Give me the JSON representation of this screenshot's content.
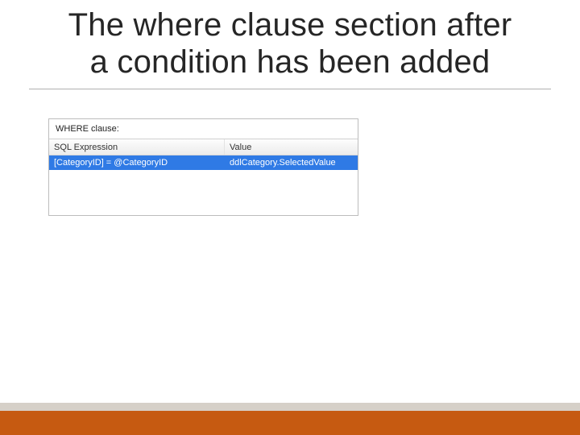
{
  "title_line1": "The where clause section after",
  "title_line2": "a condition has been added",
  "panel": {
    "label": "WHERE clause:",
    "columns": {
      "expr": "SQL Expression",
      "value": "Value"
    },
    "rows": [
      {
        "expr": "[CategoryID] = @CategoryID",
        "value": "ddlCategory.SelectedValue",
        "selected": true
      }
    ]
  }
}
